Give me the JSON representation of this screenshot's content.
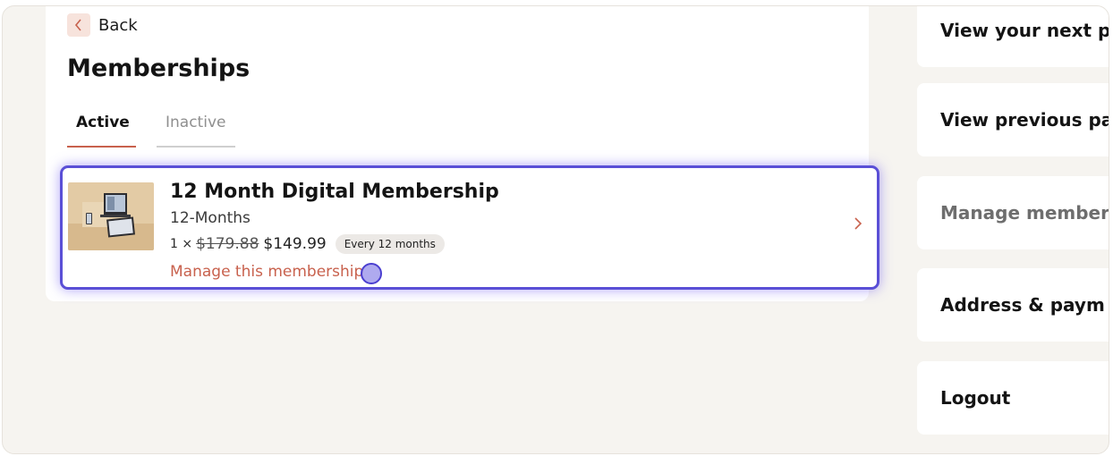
{
  "back": {
    "label": "Back"
  },
  "page_title": "Memberships",
  "tabs": [
    {
      "label": "Active",
      "active": true
    },
    {
      "label": "Inactive",
      "active": false
    }
  ],
  "membership": {
    "title": "12 Month Digital Membership",
    "subtitle": "12-Months",
    "quantity": "1 ×",
    "original_price": "$179.88",
    "price": "$149.99",
    "frequency": "Every 12 months",
    "manage_link": "Manage this membership"
  },
  "sidebar": {
    "items": [
      {
        "label": "View your next p"
      },
      {
        "label": "View previous pa"
      },
      {
        "label": "Manage member"
      },
      {
        "label": "Address & paym"
      },
      {
        "label": "Logout"
      }
    ]
  },
  "colors": {
    "accent": "#c8614d",
    "focus_ring": "#5a4fd6",
    "background": "#f6f4f0"
  }
}
